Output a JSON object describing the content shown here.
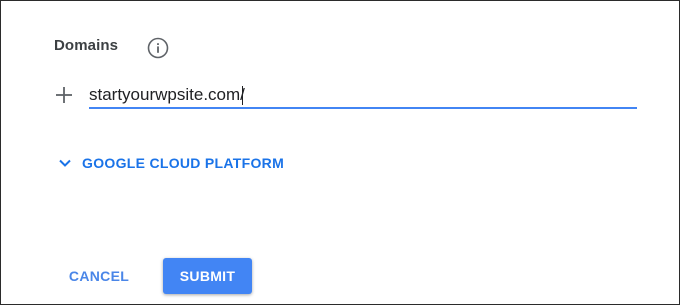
{
  "domains": {
    "title": "Domains",
    "info_icon": "info-icon",
    "add_icon": "plus-icon",
    "input_value": "startyourwpsite.com/"
  },
  "expander": {
    "icon": "chevron-down-icon",
    "label": "GOOGLE CLOUD PLATFORM"
  },
  "actions": {
    "cancel_label": "CANCEL",
    "submit_label": "SUBMIT"
  },
  "colors": {
    "accent": "#4285f4",
    "link": "#1a73e8",
    "text": "#3c4043"
  }
}
